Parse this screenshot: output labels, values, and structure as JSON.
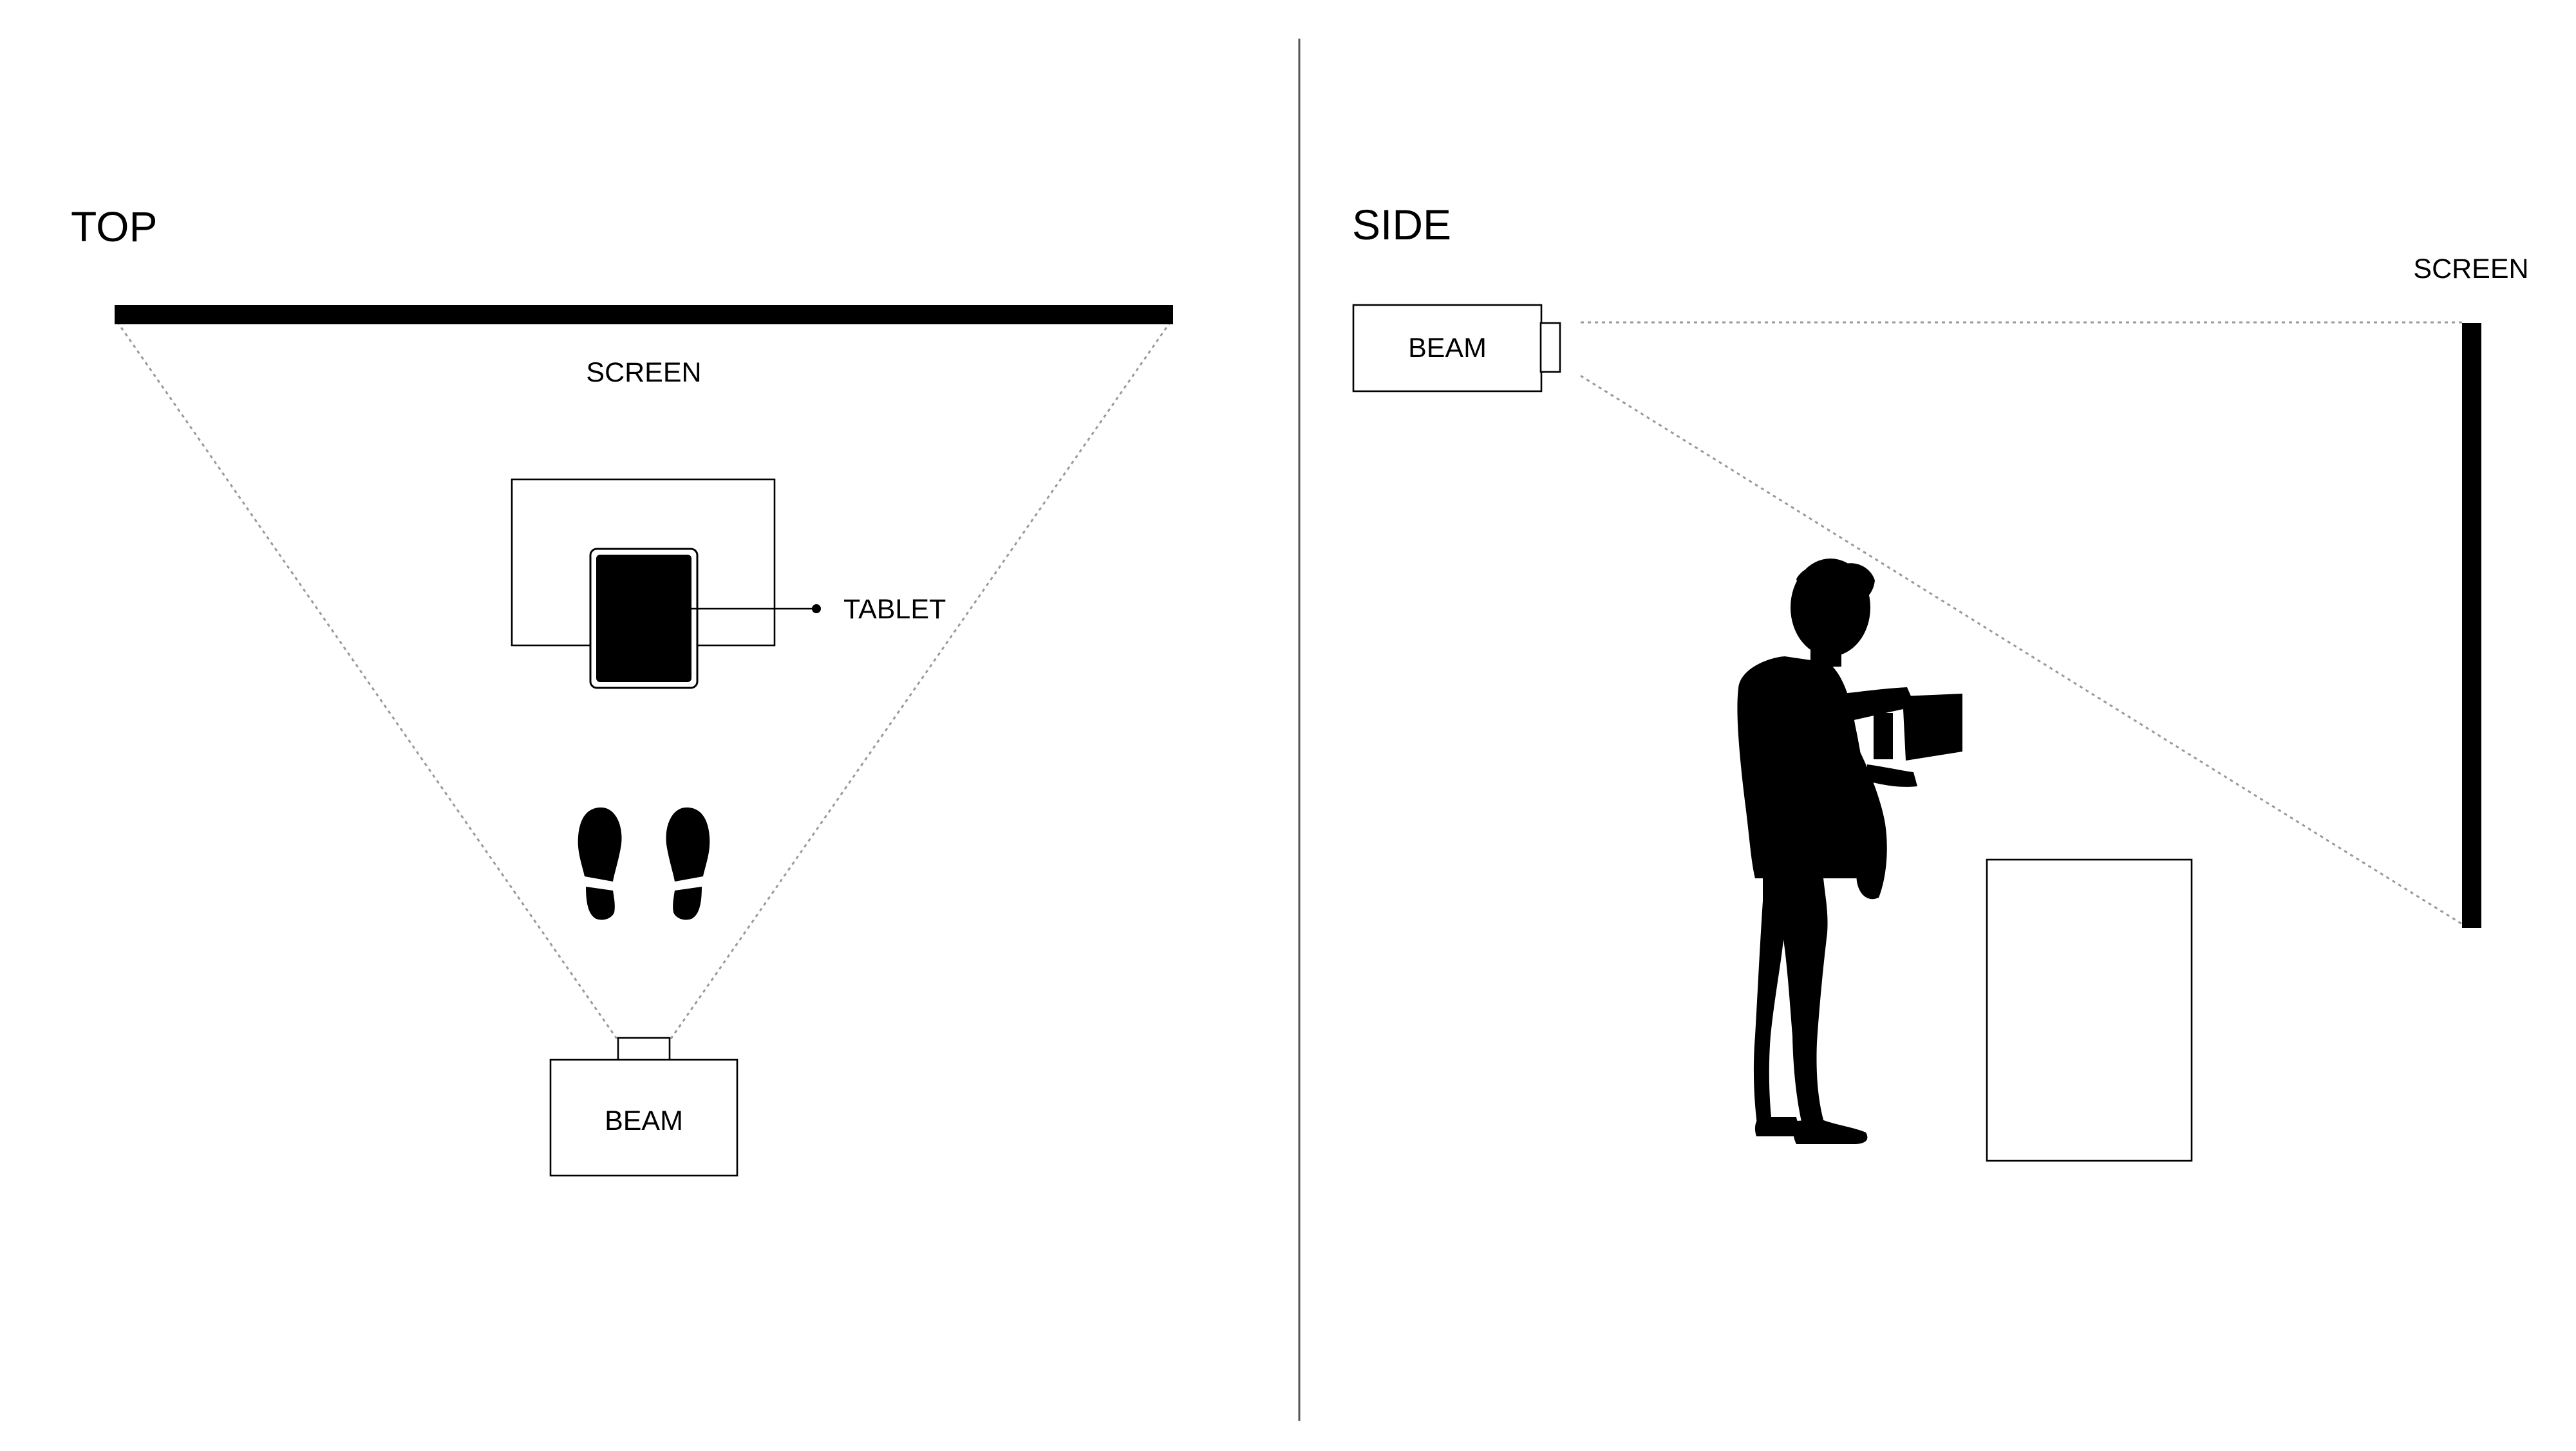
{
  "top_view": {
    "title": "TOP",
    "screen_label": "SCREEN",
    "tablet_label": "TABLET",
    "beam_label": "BEAM"
  },
  "side_view": {
    "title": "SIDE",
    "screen_label": "SCREEN",
    "beam_label": "BEAM"
  },
  "colors": {
    "ink": "#000000",
    "background": "#ffffff",
    "projection_line": "#9a9a9a"
  }
}
